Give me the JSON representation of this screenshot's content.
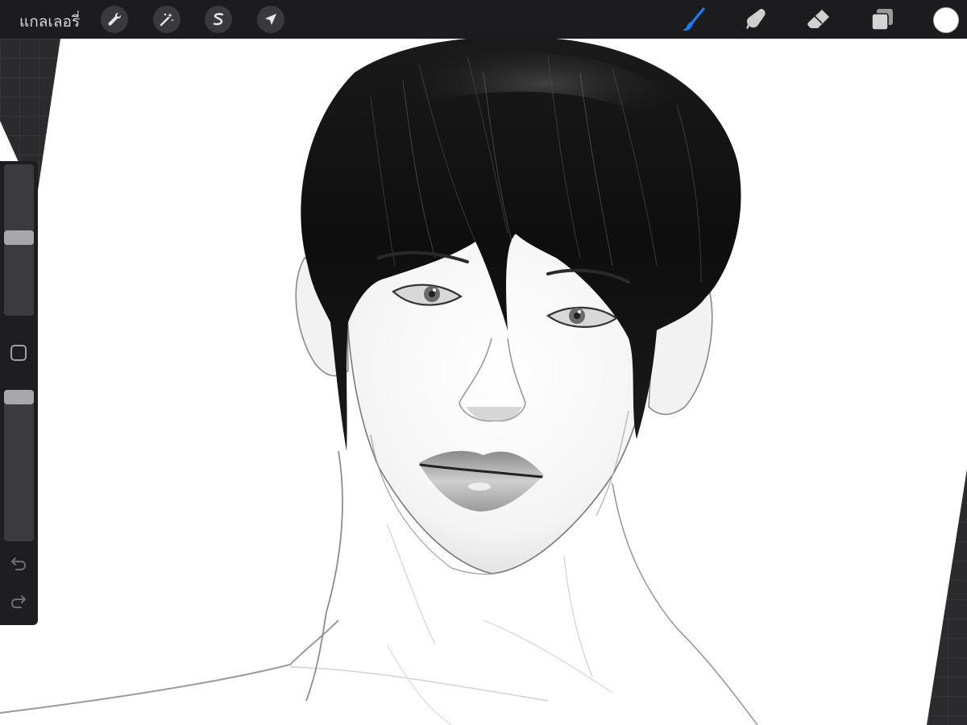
{
  "topbar": {
    "gallery_label": "แกลเลอรี่",
    "left_tools": [
      {
        "name": "actions",
        "icon": "wrench-icon"
      },
      {
        "name": "adjustments",
        "icon": "magic-wand-icon"
      },
      {
        "name": "selection",
        "icon": "selection-s-icon"
      },
      {
        "name": "transform",
        "icon": "arrow-cursor-icon"
      }
    ],
    "right_tools": [
      {
        "name": "paint",
        "icon": "brush-icon",
        "active": true
      },
      {
        "name": "smudge",
        "icon": "smudge-finger-icon",
        "active": false
      },
      {
        "name": "erase",
        "icon": "eraser-icon",
        "active": false
      },
      {
        "name": "layers",
        "icon": "layers-icon",
        "active": false
      }
    ],
    "current_color": "#ffffff",
    "active_color": "#1a7cf0"
  },
  "sidebar": {
    "brush_size": 0.52,
    "opacity": 1.0,
    "modify_icon": "square-outline-icon",
    "undo_icon": "undo-arrow-icon",
    "redo_icon": "redo-arrow-icon"
  },
  "canvas": {
    "artwork": "grayscale-portrait-illustration",
    "background": "#ffffff"
  }
}
